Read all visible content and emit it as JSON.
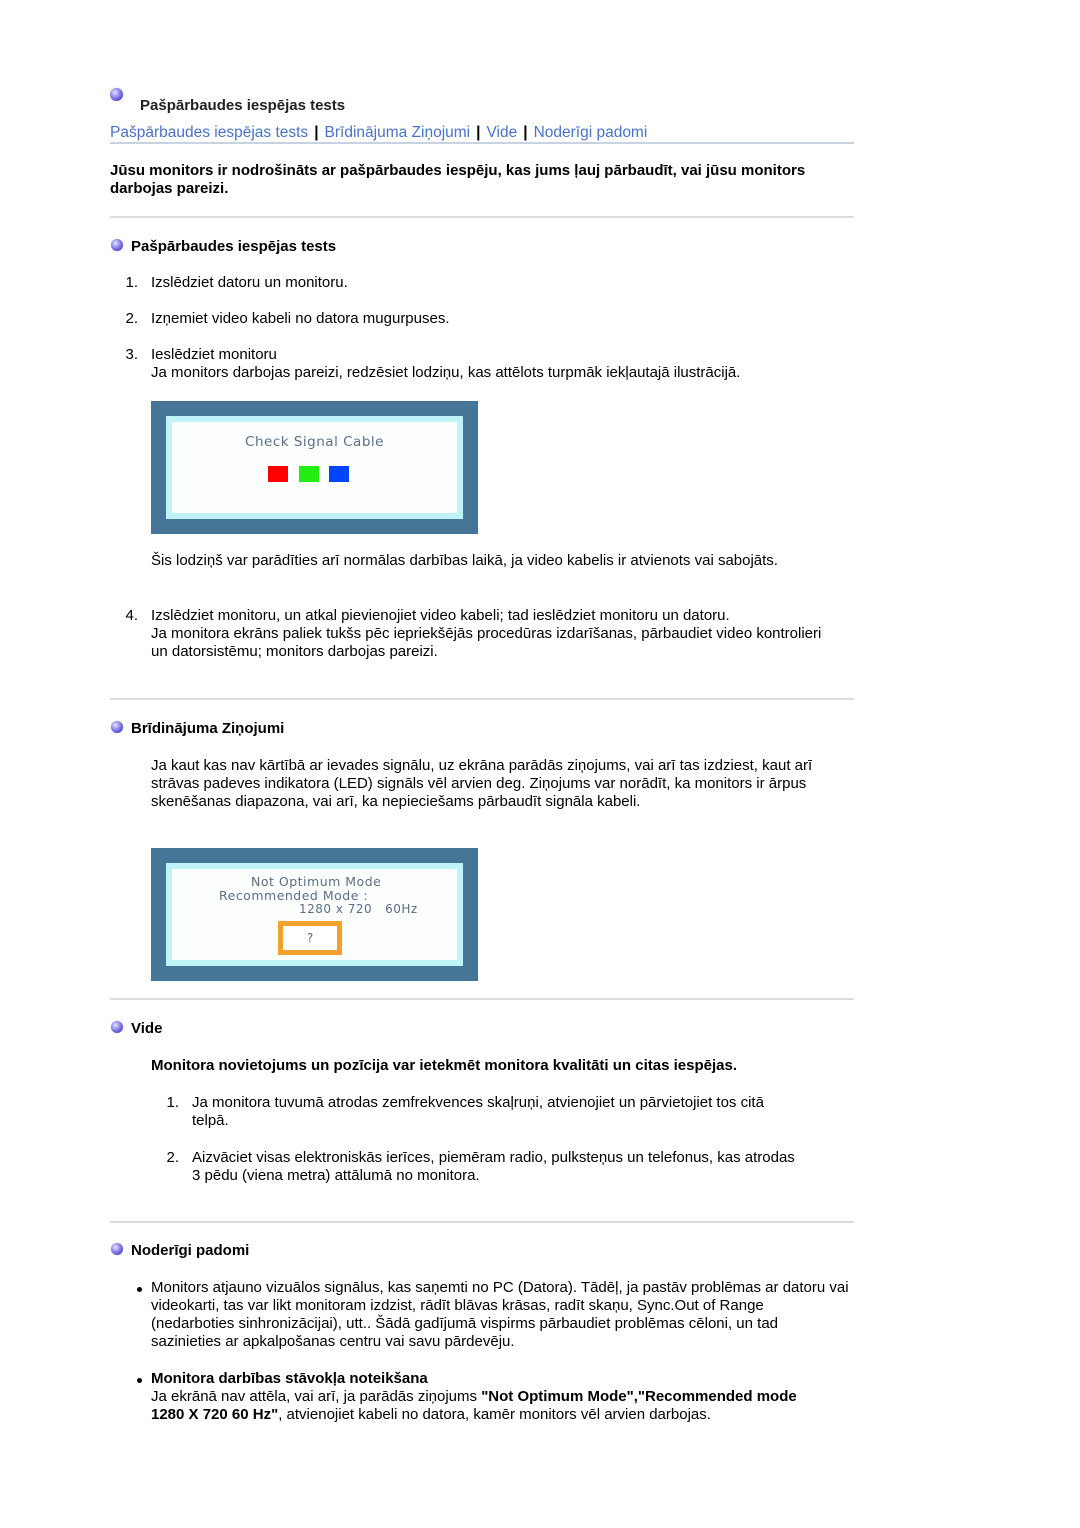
{
  "header": {
    "title": "Pašpārbaudes iespējas tests",
    "nav": [
      "Pašpārbaudes iespējas tests",
      "Brīdinājuma Ziņojumi",
      "Vide",
      "Noderīgi padomi"
    ],
    "nav_separator": "|"
  },
  "intro": "Jūsu monitors ir nodrošināts ar pašpārbaudes iespēju, kas jums ļauj pārbaudīt, vai jūsu monitors darbojas pareizi.",
  "self_test": {
    "heading": "Pašpārbaudes iespējas tests",
    "steps": [
      {
        "num": "1.",
        "text": "Izslēdziet datoru un monitoru."
      },
      {
        "num": "2.",
        "text": "Izņemiet video kabeli no datora mugurpuses."
      },
      {
        "num": "3.",
        "text": "Ieslēdziet monitoru",
        "detail": "Ja monitors darbojas pareizi, redzēsiet lodziņu, kas attēlots turpmāk iekļautajā ilustrācijā."
      },
      {
        "num": "4.",
        "text": "Izslēdziet monitoru, un atkal pievienojiet video kabeli; tad ieslēdziet monitoru un datoru.",
        "detail": "Ja monitora ekrāns paliek tukšs pēc iepriekšējās procedūras izdarīšanas, pārbaudiet video kontrolieri un datorsistēmu; monitors darbojas pareizi."
      }
    ],
    "osd_message": "Check Signal Cable",
    "osd_colors": [
      "#ff0000",
      "#22ee11",
      "#0044ff"
    ],
    "note": "Šis lodziņš var parādīties arī normālas darbības laikā, ja video kabelis ir atvienots vai sabojāts."
  },
  "warning": {
    "heading": "Brīdinājuma Ziņojumi",
    "text": "Ja kaut kas nav kārtībā ar ievades signālu, uz ekrāna parādās ziņojums, vai arī tas izdziest, kaut arī strāvas padeves indikatora (LED) signāls vēl arvien deg. Ziņojums var norādīt, ka monitors ir ārpus skenēšanas diapazona, vai arī, ka nepieciešams pārbaudīt signāla kabeli.",
    "osd_line1": "Not Optimum Mode",
    "osd_line2": "Recommended Mode :",
    "osd_line3": "1280 x 720   60Hz",
    "osd_button": "?"
  },
  "environment": {
    "heading": "Vide",
    "lead": "Monitora novietojums un pozīcija var ietekmēt monitora kvalitāti un citas iespējas.",
    "items": [
      {
        "num": "1.",
        "text": "Ja monitora tuvumā atrodas zemfrekvences skaļruņi, atvienojiet un pārvietojiet tos citā telpā."
      },
      {
        "num": "2.",
        "text": "Aizvāciet visas elektroniskās ierīces, piemēram radio, pulksteņus un telefonus, kas atrodas 3 pēdu (viena metra) attālumā no monitora."
      }
    ]
  },
  "tips": {
    "heading": "Noderīgi padomi",
    "bullet1": "Monitors atjauno vizuālos signālus, kas saņemti no PC (Datora). Tādēļ, ja pastāv problēmas ar datoru vai videokarti, tas var likt monitoram izdzist, rādīt blāvas krāsas, radīt skaņu, Sync.Out of Range (nedarboties sinhronizācijai), utt.. Šādā gadījumā vispirms pārbaudiet problēmas cēloni, un tad sazinieties ar apkalpošanas centru vai savu pārdevēju.",
    "bullet2_title": "Monitora darbības stāvokļa noteikšana",
    "bullet2_pre": "Ja ekrānā nav attēla, vai arī, ja parādās ziņojums ",
    "bullet2_bold1": "\"Not Optimum Mode\",\"Recommended mode",
    "bullet2_bold2": "1280 X 720 60 Hz\"",
    "bullet2_post": ", atvienojiet kabeli no datora, kamēr monitors vēl arvien darbojas."
  },
  "colors": {
    "link": "#4a72c8",
    "monitor_frame": "#467597",
    "monitor_inner_border": "#bff3f7",
    "osd_text": "#5b6e86",
    "osd_button_border": "#f2a22b",
    "divider": "#dcdcdc"
  }
}
